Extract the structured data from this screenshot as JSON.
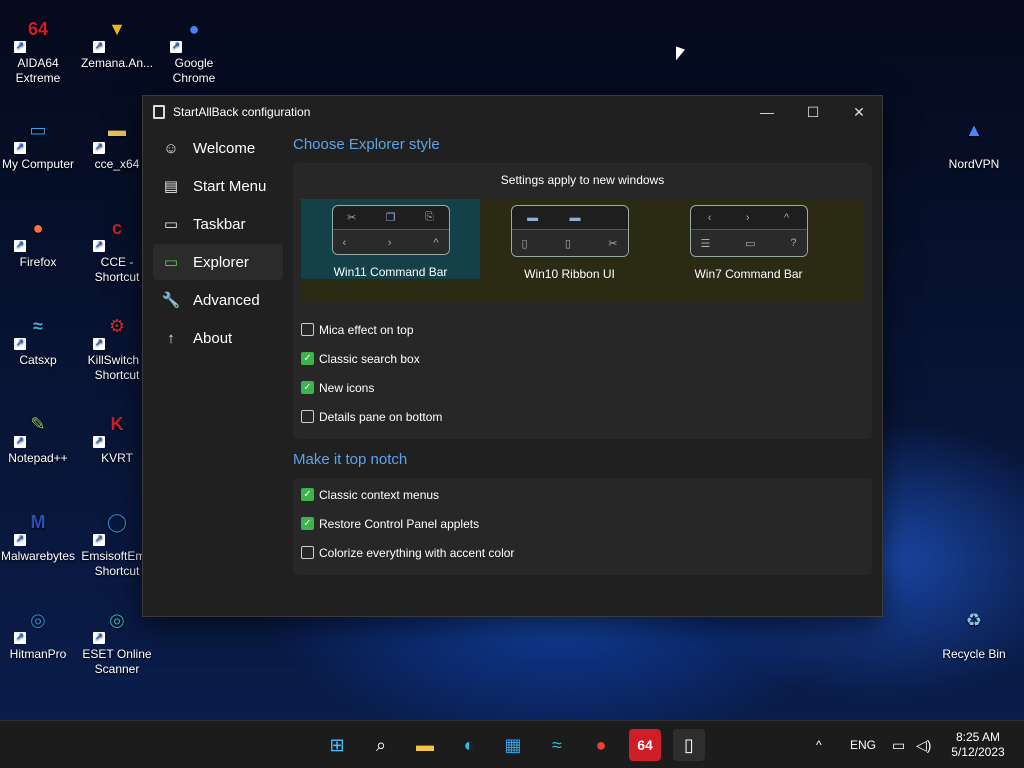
{
  "desktop": {
    "icons_left": [
      {
        "label": "AIDA64 Extreme",
        "glyph": "64",
        "color": "#d01d2a"
      },
      {
        "label": "Zemana.An...",
        "glyph": "▼",
        "color": "#e8b71a"
      },
      {
        "label": "Google Chrome",
        "glyph": "●",
        "color": "#4285f4"
      },
      {
        "label": "My Computer",
        "glyph": "▭",
        "color": "#3aa0e8"
      },
      {
        "label": "cce_x64",
        "glyph": "▬",
        "color": "#e8c25a"
      },
      {
        "label": "Firefox",
        "glyph": "●",
        "color": "#ff7139"
      },
      {
        "label": "CCE - Shortcut",
        "glyph": "c",
        "color": "#c8202a"
      },
      {
        "label": "Catsxp",
        "glyph": "≈",
        "color": "#34b8d8"
      },
      {
        "label": "KillSwitch - Shortcut",
        "glyph": "⚙",
        "color": "#c83030"
      },
      {
        "label": "Notepad++",
        "glyph": "✎",
        "color": "#8bc34a"
      },
      {
        "label": "KVRT",
        "glyph": "K",
        "color": "#d01d2a"
      },
      {
        "label": "Malwarebytes",
        "glyph": "M",
        "color": "#2c4eb8"
      },
      {
        "label": "EmsisoftEm - Shortcut",
        "glyph": "◯",
        "color": "#2a8ad8"
      },
      {
        "label": "HitmanPro",
        "glyph": "◎",
        "color": "#2a8ad8"
      },
      {
        "label": "ESET Online Scanner",
        "glyph": "◎",
        "color": "#2ab4a8"
      }
    ],
    "icons_right": [
      {
        "label": "NordVPN",
        "glyph": "▲",
        "color": "#4687ff"
      },
      {
        "label": "Recycle Bin",
        "glyph": "♻",
        "color": "#8fc1e8"
      }
    ]
  },
  "window": {
    "title": "StartAllBack configuration",
    "controls": {
      "minimize": "—",
      "maximize": "☐",
      "close": "✕"
    },
    "nav": [
      {
        "label": "Welcome",
        "icon": "smile-icon",
        "glyph": "☺"
      },
      {
        "label": "Start Menu",
        "icon": "start-menu-icon",
        "glyph": "▤"
      },
      {
        "label": "Taskbar",
        "icon": "taskbar-icon",
        "glyph": "▭"
      },
      {
        "label": "Explorer",
        "icon": "folder-icon",
        "glyph": "▭"
      },
      {
        "label": "Advanced",
        "icon": "wrench-icon",
        "glyph": "🔧"
      },
      {
        "label": "About",
        "icon": "info-icon",
        "glyph": "↑"
      }
    ],
    "active_nav": "Explorer",
    "explorer": {
      "section1_title": "Choose Explorer style",
      "note": "Settings apply to new windows",
      "styles": [
        {
          "label": "Win11 Command Bar",
          "selected": true
        },
        {
          "label": "Win10 Ribbon UI",
          "selected": false
        },
        {
          "label": "Win7 Command Bar",
          "selected": false
        }
      ],
      "options1": [
        {
          "label": "Mica effect on top",
          "checked": false
        },
        {
          "label": "Classic search box",
          "checked": true
        },
        {
          "label": "New icons",
          "checked": true
        },
        {
          "label": "Details pane on bottom",
          "checked": false
        }
      ],
      "section2_title": "Make it top notch",
      "options2": [
        {
          "label": "Classic context menus",
          "checked": true
        },
        {
          "label": "Restore Control Panel applets",
          "checked": true
        },
        {
          "label": "Colorize everything with accent color",
          "checked": false
        }
      ]
    }
  },
  "taskbar": {
    "apps": [
      {
        "name": "start-icon",
        "glyph": "⊞",
        "color": "#4cc2ff"
      },
      {
        "name": "search-icon",
        "glyph": "⌕",
        "color": "#ffffff"
      },
      {
        "name": "file-explorer-icon",
        "glyph": "▬",
        "color": "#f4c542"
      },
      {
        "name": "edge-icon",
        "glyph": "◐",
        "color": "#2fb7e8"
      },
      {
        "name": "store-icon",
        "glyph": "▦",
        "color": "#3aa0e8"
      },
      {
        "name": "catsxp-icon",
        "glyph": "≈",
        "color": "#34b8d8"
      },
      {
        "name": "chrome-icon",
        "glyph": "●",
        "color": "#e94235"
      },
      {
        "name": "aida64-icon",
        "glyph": "64",
        "color": "#d01d2a"
      },
      {
        "name": "startallback-icon",
        "glyph": "▯",
        "color": "#ffffff"
      }
    ],
    "tray": {
      "chevron": "^",
      "language": "ENG",
      "time": "8:25 AM",
      "date": "5/12/2023"
    }
  }
}
